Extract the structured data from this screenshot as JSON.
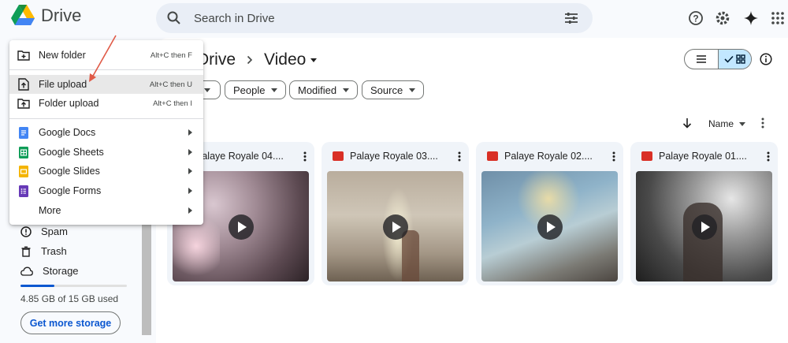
{
  "app": {
    "name": "Drive"
  },
  "search": {
    "placeholder": "Search in Drive"
  },
  "breadcrumb": {
    "parent": "Drive",
    "current": "Video"
  },
  "filters": [
    "People",
    "Modified",
    "Source"
  ],
  "sort": {
    "label": "Name"
  },
  "files": [
    {
      "title": "Palaye Royale 04...."
    },
    {
      "title": "Palaye Royale 03...."
    },
    {
      "title": "Palaye Royale 02...."
    },
    {
      "title": "Palaye Royale 01...."
    }
  ],
  "new_menu": {
    "items": [
      {
        "label": "New folder",
        "shortcut": "Alt+C then F"
      },
      {
        "label": "File upload",
        "shortcut": "Alt+C then U"
      },
      {
        "label": "Folder upload",
        "shortcut": "Alt+C then I"
      },
      {
        "label": "Google Docs"
      },
      {
        "label": "Google Sheets"
      },
      {
        "label": "Google Slides"
      },
      {
        "label": "Google Forms"
      },
      {
        "label": "More"
      }
    ]
  },
  "sidebar": {
    "items": [
      {
        "label": "Spam",
        "icon": "spam-icon"
      },
      {
        "label": "Trash",
        "icon": "trash-icon"
      },
      {
        "label": "Storage",
        "icon": "cloud-icon"
      }
    ],
    "storage_used_text": "4.85 GB of 15 GB used",
    "storage_fraction": 0.32,
    "get_storage_label": "Get more storage"
  },
  "colors": {
    "accent": "#0b57d0",
    "arrow": "#e05a47",
    "selected_toggle": "#c2e7ff"
  }
}
